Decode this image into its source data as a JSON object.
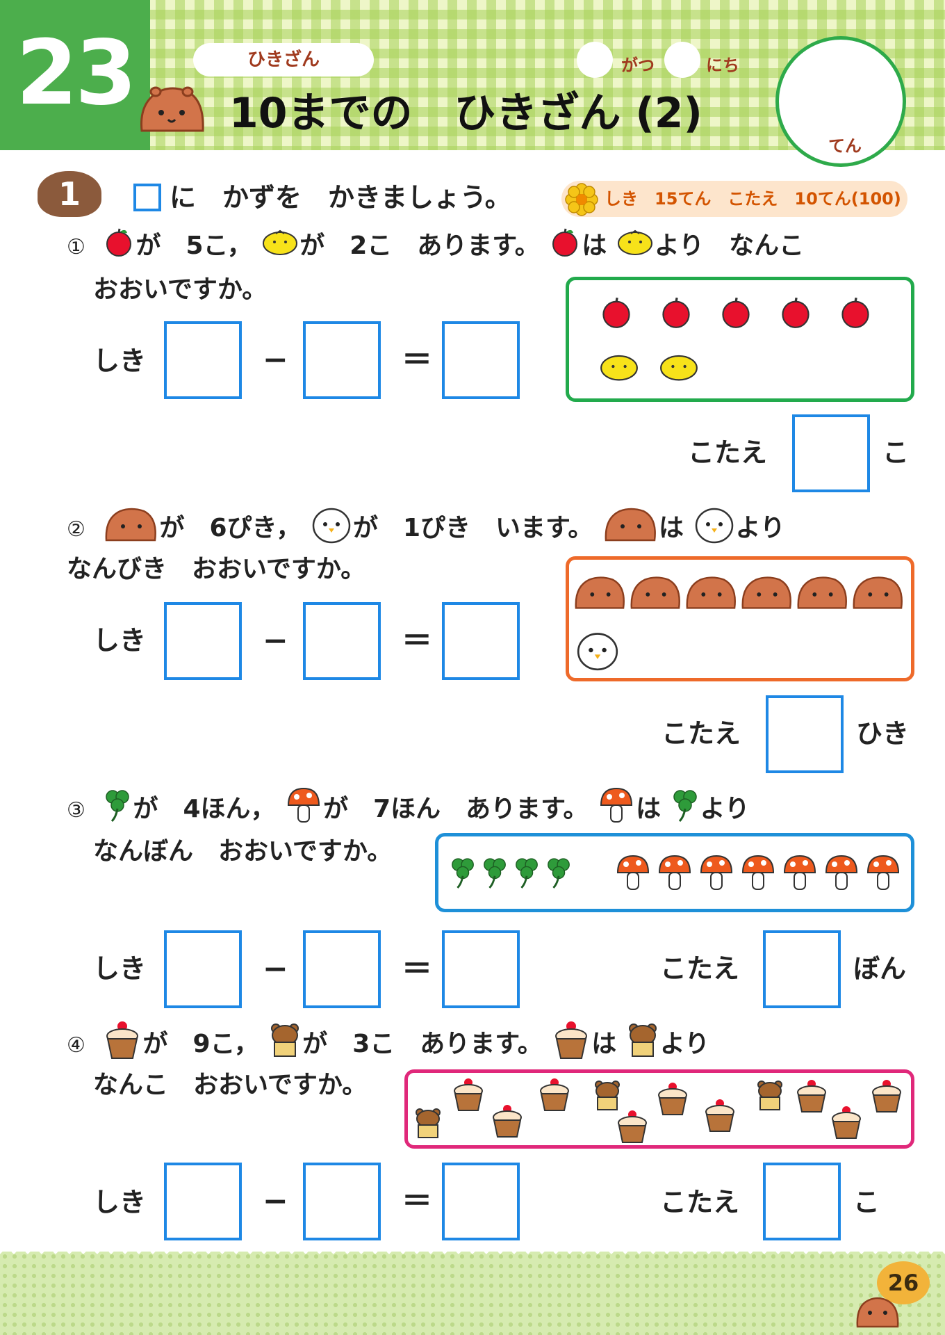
{
  "header": {
    "lesson_number": "23",
    "topic": "ひきざん",
    "title": "10までの　ひきざん (2)",
    "month_label": "がつ",
    "day_label": "にち",
    "score_unit": "てん"
  },
  "section": {
    "badge": "1",
    "instruction": "に　かずを　かきましょう。",
    "points": "しき　15てん　こたえ　10てん(100)"
  },
  "labels": {
    "shiki": "しき",
    "kotae": "こたえ",
    "minus": "−",
    "equals": "＝"
  },
  "questions": [
    {
      "mark": "①",
      "line1": [
        "が　5こ，",
        "が　2こ　あります。",
        "は",
        "より　なんこ"
      ],
      "line2": "おおいですか。",
      "unit": "こ",
      "icons": [
        "apple-icon",
        "yuzu-icon"
      ],
      "frame_color": "#22aa4c"
    },
    {
      "mark": "②",
      "line1": [
        "が　6ぴき，",
        "が　1ぴき　います。",
        "は",
        "より"
      ],
      "line2": "なんびき　おおいですか。",
      "unit": "ひき",
      "icons": [
        "capybara-icon",
        "chick-icon"
      ],
      "frame_color": "#ee6a2a"
    },
    {
      "mark": "③",
      "line1": [
        "が　4ほん，",
        "が　7ほん　あります。",
        "は",
        "より"
      ],
      "line2": "なんぼん　おおいですか。",
      "unit": "ぼん",
      "icons": [
        "clover-icon",
        "mushroom-icon"
      ],
      "frame_color": "#1e90d8"
    },
    {
      "mark": "④",
      "line1": [
        "が　9こ，",
        "が　3こ　あります。",
        "は",
        "より"
      ],
      "line2": "なんこ　おおいですか。",
      "unit": "こ",
      "icons": [
        "cupcake-icon",
        "bear-bread-icon"
      ],
      "frame_color": "#e0287a"
    }
  ],
  "footer": {
    "page_number": "26"
  }
}
